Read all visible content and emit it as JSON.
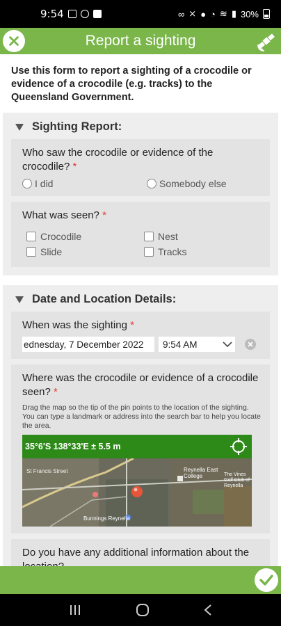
{
  "status_bar": {
    "time": "9:54",
    "battery": "30%"
  },
  "header": {
    "title": "Report a sighting"
  },
  "intro": "Use this form to report a sighting of a crocodile or evidence of a crocodile (e.g. tracks) to the Queensland Government.",
  "sighting_report": {
    "title": "Sighting Report:",
    "who_question": "Who saw the crocodile or evidence of the crocodile?",
    "who_options": [
      "I did",
      "Somebody else"
    ],
    "what_question": "What was seen?",
    "what_options": [
      "Crocodile",
      "Nest",
      "Slide",
      "Tracks"
    ]
  },
  "date_location": {
    "title": "Date and Location Details:",
    "when_question": "When was the sighting",
    "date_value": "ednesday, 7 December 2022",
    "time_value": "9:54 AM",
    "where_question": "Where was the crocodile or evidence of a crocodile seen?",
    "where_helper": "Drag the map so the tip of the pin points to the location of the sighting. You can type a landmark or address into the search bar to help you locate the area.",
    "coords": "35°6'S 138°33'E ± 5.5 m",
    "map_labels": {
      "street": "St Francis Street",
      "college": "Reynella East College",
      "shop": "Bunnings Reynella",
      "reserve": "The Vines Golf Club of Reynella"
    },
    "additional_question": "Do you have any additional information about the location?"
  },
  "required_marker": "*",
  "colors": {
    "brand_green": "#7ab64a",
    "map_bar": "#2d8a19",
    "required": "#e53935"
  }
}
